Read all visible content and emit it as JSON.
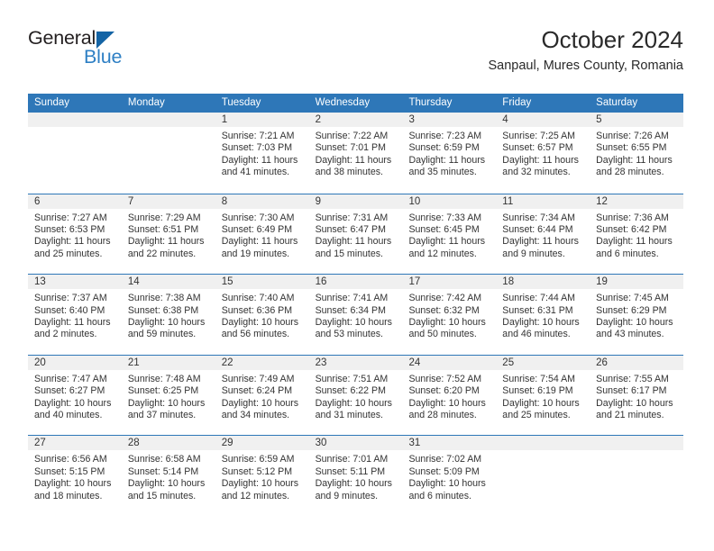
{
  "brand": {
    "word1": "General",
    "word2": "Blue",
    "triangle_color": "#1464a5",
    "word2_color": "#2e7fc4"
  },
  "header": {
    "title": "October 2024",
    "subtitle": "Sanpaul, Mures County, Romania"
  },
  "theme": {
    "header_blue": "#2e77b8",
    "daynum_band": "#f0f0f0",
    "text": "#333333"
  },
  "calendar": {
    "weekday_headers": [
      "Sunday",
      "Monday",
      "Tuesday",
      "Wednesday",
      "Thursday",
      "Friday",
      "Saturday"
    ],
    "weeks": [
      [
        {
          "day": "",
          "lines": []
        },
        {
          "day": "",
          "lines": []
        },
        {
          "day": "1",
          "lines": [
            "Sunrise: 7:21 AM",
            "Sunset: 7:03 PM",
            "Daylight: 11 hours",
            "and 41 minutes."
          ]
        },
        {
          "day": "2",
          "lines": [
            "Sunrise: 7:22 AM",
            "Sunset: 7:01 PM",
            "Daylight: 11 hours",
            "and 38 minutes."
          ]
        },
        {
          "day": "3",
          "lines": [
            "Sunrise: 7:23 AM",
            "Sunset: 6:59 PM",
            "Daylight: 11 hours",
            "and 35 minutes."
          ]
        },
        {
          "day": "4",
          "lines": [
            "Sunrise: 7:25 AM",
            "Sunset: 6:57 PM",
            "Daylight: 11 hours",
            "and 32 minutes."
          ]
        },
        {
          "day": "5",
          "lines": [
            "Sunrise: 7:26 AM",
            "Sunset: 6:55 PM",
            "Daylight: 11 hours",
            "and 28 minutes."
          ]
        }
      ],
      [
        {
          "day": "6",
          "lines": [
            "Sunrise: 7:27 AM",
            "Sunset: 6:53 PM",
            "Daylight: 11 hours",
            "and 25 minutes."
          ]
        },
        {
          "day": "7",
          "lines": [
            "Sunrise: 7:29 AM",
            "Sunset: 6:51 PM",
            "Daylight: 11 hours",
            "and 22 minutes."
          ]
        },
        {
          "day": "8",
          "lines": [
            "Sunrise: 7:30 AM",
            "Sunset: 6:49 PM",
            "Daylight: 11 hours",
            "and 19 minutes."
          ]
        },
        {
          "day": "9",
          "lines": [
            "Sunrise: 7:31 AM",
            "Sunset: 6:47 PM",
            "Daylight: 11 hours",
            "and 15 minutes."
          ]
        },
        {
          "day": "10",
          "lines": [
            "Sunrise: 7:33 AM",
            "Sunset: 6:45 PM",
            "Daylight: 11 hours",
            "and 12 minutes."
          ]
        },
        {
          "day": "11",
          "lines": [
            "Sunrise: 7:34 AM",
            "Sunset: 6:44 PM",
            "Daylight: 11 hours",
            "and 9 minutes."
          ]
        },
        {
          "day": "12",
          "lines": [
            "Sunrise: 7:36 AM",
            "Sunset: 6:42 PM",
            "Daylight: 11 hours",
            "and 6 minutes."
          ]
        }
      ],
      [
        {
          "day": "13",
          "lines": [
            "Sunrise: 7:37 AM",
            "Sunset: 6:40 PM",
            "Daylight: 11 hours",
            "and 2 minutes."
          ]
        },
        {
          "day": "14",
          "lines": [
            "Sunrise: 7:38 AM",
            "Sunset: 6:38 PM",
            "Daylight: 10 hours",
            "and 59 minutes."
          ]
        },
        {
          "day": "15",
          "lines": [
            "Sunrise: 7:40 AM",
            "Sunset: 6:36 PM",
            "Daylight: 10 hours",
            "and 56 minutes."
          ]
        },
        {
          "day": "16",
          "lines": [
            "Sunrise: 7:41 AM",
            "Sunset: 6:34 PM",
            "Daylight: 10 hours",
            "and 53 minutes."
          ]
        },
        {
          "day": "17",
          "lines": [
            "Sunrise: 7:42 AM",
            "Sunset: 6:32 PM",
            "Daylight: 10 hours",
            "and 50 minutes."
          ]
        },
        {
          "day": "18",
          "lines": [
            "Sunrise: 7:44 AM",
            "Sunset: 6:31 PM",
            "Daylight: 10 hours",
            "and 46 minutes."
          ]
        },
        {
          "day": "19",
          "lines": [
            "Sunrise: 7:45 AM",
            "Sunset: 6:29 PM",
            "Daylight: 10 hours",
            "and 43 minutes."
          ]
        }
      ],
      [
        {
          "day": "20",
          "lines": [
            "Sunrise: 7:47 AM",
            "Sunset: 6:27 PM",
            "Daylight: 10 hours",
            "and 40 minutes."
          ]
        },
        {
          "day": "21",
          "lines": [
            "Sunrise: 7:48 AM",
            "Sunset: 6:25 PM",
            "Daylight: 10 hours",
            "and 37 minutes."
          ]
        },
        {
          "day": "22",
          "lines": [
            "Sunrise: 7:49 AM",
            "Sunset: 6:24 PM",
            "Daylight: 10 hours",
            "and 34 minutes."
          ]
        },
        {
          "day": "23",
          "lines": [
            "Sunrise: 7:51 AM",
            "Sunset: 6:22 PM",
            "Daylight: 10 hours",
            "and 31 minutes."
          ]
        },
        {
          "day": "24",
          "lines": [
            "Sunrise: 7:52 AM",
            "Sunset: 6:20 PM",
            "Daylight: 10 hours",
            "and 28 minutes."
          ]
        },
        {
          "day": "25",
          "lines": [
            "Sunrise: 7:54 AM",
            "Sunset: 6:19 PM",
            "Daylight: 10 hours",
            "and 25 minutes."
          ]
        },
        {
          "day": "26",
          "lines": [
            "Sunrise: 7:55 AM",
            "Sunset: 6:17 PM",
            "Daylight: 10 hours",
            "and 21 minutes."
          ]
        }
      ],
      [
        {
          "day": "27",
          "lines": [
            "Sunrise: 6:56 AM",
            "Sunset: 5:15 PM",
            "Daylight: 10 hours",
            "and 18 minutes."
          ]
        },
        {
          "day": "28",
          "lines": [
            "Sunrise: 6:58 AM",
            "Sunset: 5:14 PM",
            "Daylight: 10 hours",
            "and 15 minutes."
          ]
        },
        {
          "day": "29",
          "lines": [
            "Sunrise: 6:59 AM",
            "Sunset: 5:12 PM",
            "Daylight: 10 hours",
            "and 12 minutes."
          ]
        },
        {
          "day": "30",
          "lines": [
            "Sunrise: 7:01 AM",
            "Sunset: 5:11 PM",
            "Daylight: 10 hours",
            "and 9 minutes."
          ]
        },
        {
          "day": "31",
          "lines": [
            "Sunrise: 7:02 AM",
            "Sunset: 5:09 PM",
            "Daylight: 10 hours",
            "and 6 minutes."
          ]
        },
        {
          "day": "",
          "lines": []
        },
        {
          "day": "",
          "lines": []
        }
      ]
    ]
  }
}
